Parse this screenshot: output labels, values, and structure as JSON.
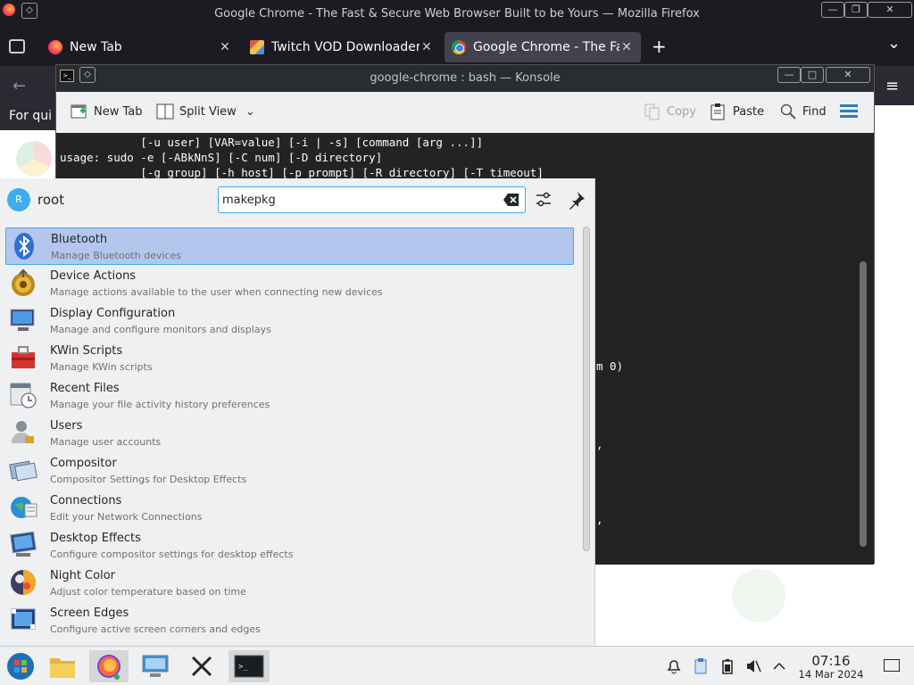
{
  "firefox": {
    "window_title": "Google Chrome - The Fast & Secure Web Browser Built to be Yours — Mozilla Firefox",
    "window_controls": {
      "minimize": "—",
      "maximize": "❐",
      "close": "✕"
    },
    "tabs": [
      {
        "label": "New Tab",
        "close": "✕",
        "favicon": "firefox-icon"
      },
      {
        "label": "Twitch VOD Downloader",
        "close": "✕",
        "favicon": "twitch-downloader-icon"
      },
      {
        "label": "Google Chrome - The Fas",
        "close": "✕",
        "favicon": "chrome-icon"
      }
    ],
    "new_tab": "+",
    "tab_list": "⌄",
    "notification_prefix": "For qui"
  },
  "konsole": {
    "window_title": "google-chrome : bash — Konsole",
    "toolbar": {
      "new_tab": "New Tab",
      "split_view": "Split View",
      "copy": "Copy",
      "paste": "Paste",
      "find": "Find"
    },
    "terminal_lines": [
      "            [-u user] [VAR=value] [-i | -s] [command [arg ...]]",
      "usage: sudo -e [-ABkNnS] [-C num] [-D directory]",
      "            [-g group] [-h host] [-p prompt] [-R directory] [-T timeout]"
    ],
    "terminal_fragments": {
      "f1": "m 0)",
      "f2": ",",
      "f3": ","
    }
  },
  "krunner": {
    "user_initial": "R",
    "user_name": "root",
    "search_value": "makepkg",
    "results": [
      {
        "title": "Bluetooth",
        "subtitle": "Manage Bluetooth devices",
        "icon": "bluetooth-icon"
      },
      {
        "title": "Device Actions",
        "subtitle": "Manage actions available to the user when connecting new devices",
        "icon": "device-actions-gear-icon"
      },
      {
        "title": "Display Configuration",
        "subtitle": "Manage and configure monitors and displays",
        "icon": "monitor-icon"
      },
      {
        "title": "KWin Scripts",
        "subtitle": "Manage KWin scripts",
        "icon": "toolbox-icon"
      },
      {
        "title": "Recent Files",
        "subtitle": "Manage your file activity history preferences",
        "icon": "calendar-clock-icon"
      },
      {
        "title": "Users",
        "subtitle": "Manage user accounts",
        "icon": "user-lock-icon"
      },
      {
        "title": "Compositor",
        "subtitle": "Compositor Settings for Desktop Effects",
        "icon": "compositor-icon"
      },
      {
        "title": "Connections",
        "subtitle": "Edit your Network Connections",
        "icon": "network-globe-icon"
      },
      {
        "title": "Desktop Effects",
        "subtitle": "Configure compositor settings for desktop effects",
        "icon": "desktop-effects-icon"
      },
      {
        "title": "Night Color",
        "subtitle": "Adjust color temperature based on time",
        "icon": "night-color-icon"
      },
      {
        "title": "Screen Edges",
        "subtitle": "Configure active screen corners and edges",
        "icon": "screen-edges-icon"
      }
    ]
  },
  "taskbar": {
    "apps": [
      "start-menu-icon",
      "file-manager-icon",
      "firefox-icon",
      "system-settings-icon",
      "x-app-icon",
      "konsole-icon"
    ],
    "tray": [
      "notifications-icon",
      "clipboard-icon",
      "battery-icon",
      "volume-muted-icon",
      "expand-tray-icon"
    ],
    "clock_time": "07:16",
    "clock_date": "14 Mar 2024"
  }
}
